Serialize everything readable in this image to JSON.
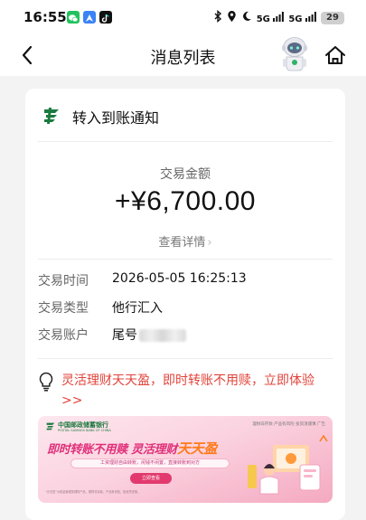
{
  "status_bar": {
    "time": "16:55",
    "battery": "29",
    "signal_labels": [
      "5G",
      "5G"
    ],
    "icons": [
      "wechat-icon",
      "maps-icon",
      "tiktok-icon",
      "bluetooth-icon",
      "location-icon",
      "moon-icon",
      "signal-icon",
      "signal-icon",
      "battery-icon"
    ]
  },
  "nav": {
    "title": "消息列表",
    "back_icon": "chevron-left-icon",
    "assistant_icon": "robot-assistant-icon",
    "home_icon": "home-icon"
  },
  "card": {
    "title": "转入到账通知",
    "amount_label": "交易金额",
    "amount": "+¥6,700.00",
    "details_link": "查看详情",
    "rows": [
      {
        "key": "交易时间",
        "value": "2026-05-05 16:25:13"
      },
      {
        "key": "交易类型",
        "value": "他行汇入"
      },
      {
        "key": "交易账户",
        "value": "尾号"
      }
    ],
    "promo_text": "灵活理财天天盈，即时转账不用赎，立即体验>>"
  },
  "banner": {
    "bank_name": "中国邮政储蓄银行",
    "bank_name_en": "POSTAL SAVINGS BANK OF CHINA",
    "top_right": "理财非存款 产品有风险 投资须谨慎  广告",
    "slogan_a": "即时转账不用赎",
    "slogan_b": "灵活理财",
    "slogan_c": "天天盈",
    "subline": "工资理财自由转账，闲钱不闲置，直接转账到对方",
    "button": "立即查看",
    "footnote": "“天天盈”为现金管理类理财产品，理财非存款，产品有风险，投资须谨慎。",
    "colors": {
      "pink": "#e0307a",
      "orange": "#ff7a1a",
      "green": "#1b7a3e"
    }
  },
  "colors": {
    "accent_red": "#e2433a",
    "psbc_green": "#1b7a3e"
  }
}
